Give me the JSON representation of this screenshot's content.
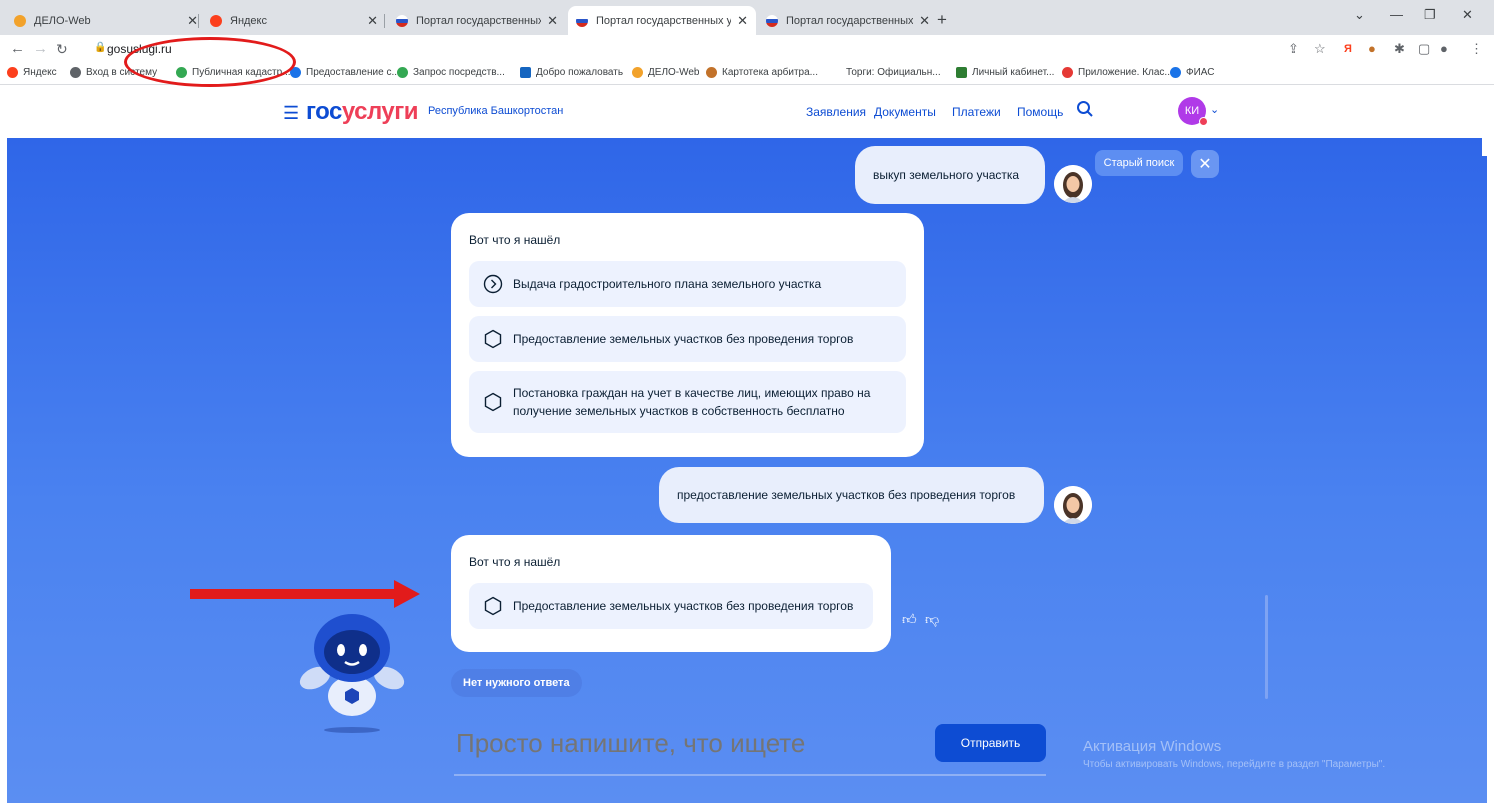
{
  "browser": {
    "tabs": [
      {
        "title": "ДЕЛО-Web",
        "active": false,
        "favicon_color": "#f2a22b"
      },
      {
        "title": "Яндекс",
        "active": false,
        "favicon_color": "#fc3f1d"
      },
      {
        "title": "Портал государственных услуг",
        "active": false,
        "favicon_color": "#2a55c9"
      },
      {
        "title": "Портал государственных услуг",
        "active": true,
        "favicon_color": "#2a55c9"
      },
      {
        "title": "Портал государственных услуг",
        "active": false,
        "favicon_color": "#2a55c9"
      }
    ],
    "url": "gosuslugi.ru",
    "bookmarks": [
      {
        "label": "Яндекс",
        "icon_color": "#fc3f1d"
      },
      {
        "label": "Вход в систему",
        "icon_color": "#5f6368"
      },
      {
        "label": "Публичная кадастр...",
        "icon_color": "#34a853"
      },
      {
        "label": "Предоставление с...",
        "icon_color": "#1a73e8"
      },
      {
        "label": "Запрос посредств...",
        "icon_color": "#34a853"
      },
      {
        "label": "Добро пожаловать",
        "icon_color": "#1565c0"
      },
      {
        "label": "ДЕЛО-Web",
        "icon_color": "#f2a22b"
      },
      {
        "label": "Картотека арбитра...",
        "icon_color": "#c2722a"
      },
      {
        "label": "Торги: Официальн...",
        "icon_color": "#ffffff"
      },
      {
        "label": "Личный кабинет...",
        "icon_color": "#2e7d32"
      },
      {
        "label": "Приложение. Клас...",
        "icon_color": "#e53935"
      },
      {
        "label": "ФИАС",
        "icon_color": "#1a73e8"
      }
    ]
  },
  "header": {
    "logo_part1": "гос",
    "logo_part2": "услуги",
    "region": "Республика Башкортостан",
    "nav": [
      "Заявления",
      "Документы",
      "Платежи",
      "Помощь"
    ],
    "avatar_initials": "КИ"
  },
  "chat": {
    "old_search_label": "Старый поиск",
    "messages": {
      "user1": "выкуп земельного участка",
      "bot1_head": "Вот что я нашёл",
      "bot1_options": [
        "Выдача градостроительного плана земельного участка",
        "Предоставление земельных участков без проведения торгов",
        "Постановка граждан на учет в качестве лиц, имеющих право на получение земельных участков в собственность бесплатно"
      ],
      "user2": "предоставление земельных участков без проведения торгов",
      "bot2_head": "Вот что я нашёл",
      "bot2_options": [
        "Предоставление земельных участков без проведения торгов"
      ]
    },
    "no_answer_label": "Нет нужного ответа",
    "input_placeholder": "Просто напишите, что ищете",
    "send_label": "Отправить"
  },
  "watermark": {
    "title": "Активация Windows",
    "subtitle": "Чтобы активировать Windows, перейдите в раздел \"Параметры\"."
  },
  "colors": {
    "brand_blue": "#0d4cd3",
    "brand_red": "#ee3f58",
    "annotation_red": "#e21b1b"
  }
}
